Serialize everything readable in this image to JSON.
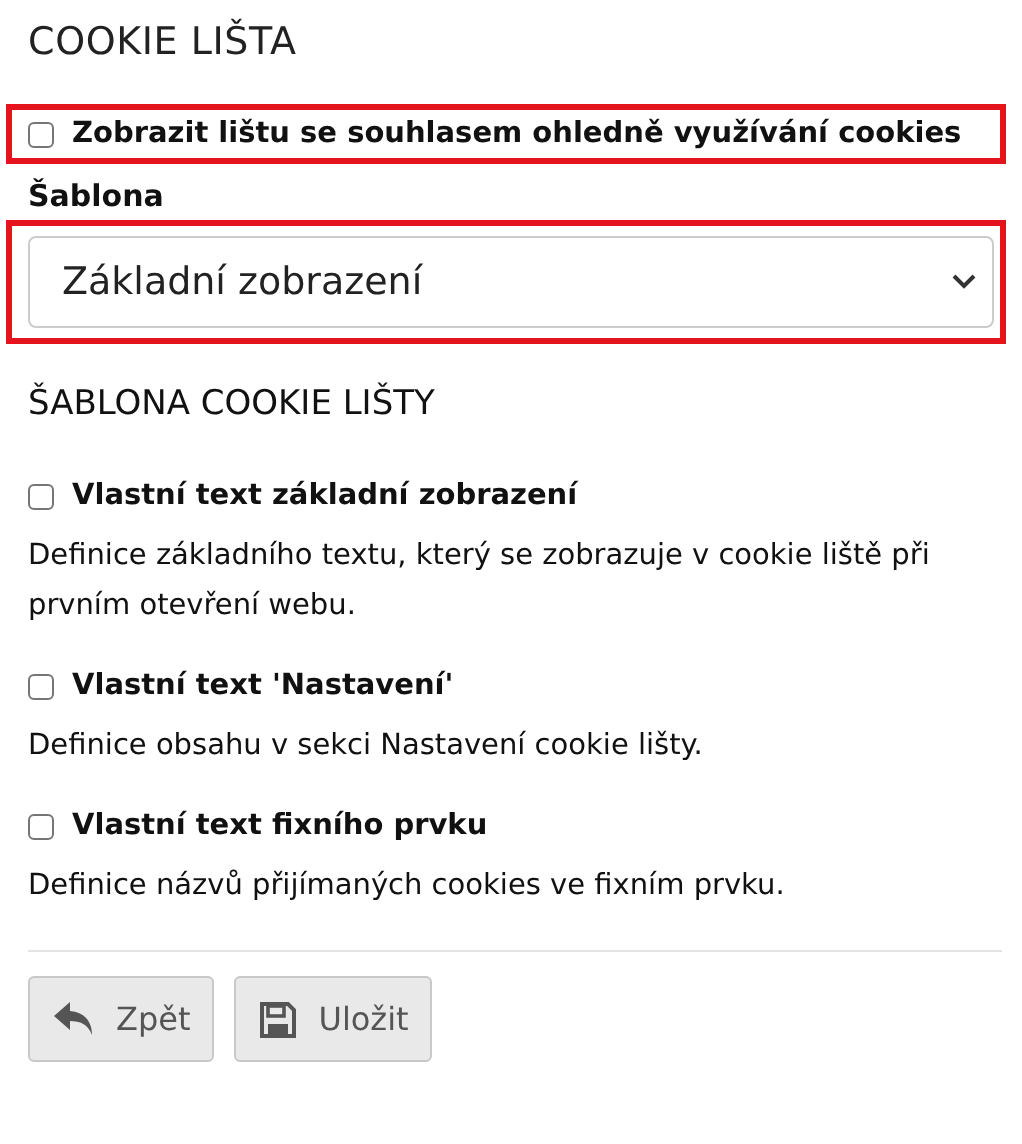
{
  "title": "COOKIE LIŠTA",
  "show_bar": {
    "label": "Zobrazit lištu se souhlasem ohledně využívání cookies",
    "checked": false,
    "highlighted": true
  },
  "template": {
    "label": "Šablona",
    "value": "Základní zobrazení",
    "highlighted": true
  },
  "section_title": "ŠABLONA COOKIE LIŠTY",
  "options": [
    {
      "label": "Vlastní text základní zobrazení",
      "checked": false,
      "description": "Definice základního textu, který se zobrazuje v cookie liště při prvním otevření webu."
    },
    {
      "label": "Vlastní text 'Nastavení'",
      "checked": false,
      "description": "Definice obsahu v sekci Nastavení cookie lišty."
    },
    {
      "label": "Vlastní text fixního prvku",
      "checked": false,
      "description": "Definice názvů přijímaných cookies ve fixním prvku."
    }
  ],
  "buttons": [
    {
      "kind": "back",
      "label": "Zpět"
    },
    {
      "kind": "save",
      "label": "Uložit"
    }
  ]
}
